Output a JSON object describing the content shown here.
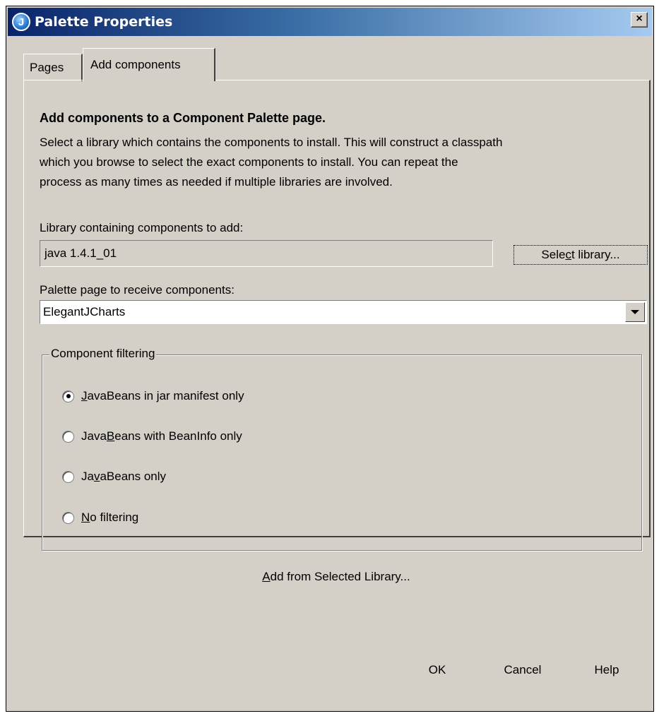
{
  "window": {
    "title": "Palette Properties",
    "close_glyph": "×"
  },
  "tabs": [
    {
      "label": "Pages",
      "selected": false
    },
    {
      "label": "Add components",
      "selected": true
    }
  ],
  "panel": {
    "heading": "Add components to a Component Palette page.",
    "description": [
      "Select a library which contains the components to install.  This will construct a classpath",
      "which you browse to select the exact components to install.  You can repeat the",
      "process as many times as needed if multiple libraries are involved."
    ],
    "library_label": "Library containing components to add:",
    "library_value": "java 1.4.1_01",
    "select_library_button": {
      "pre": "Sele",
      "mnemonic": "c",
      "post": "t library..."
    },
    "palette_label": "Palette page to receive components:",
    "palette_value": "ElegantJCharts"
  },
  "filtering": {
    "title": "Component filtering",
    "options": [
      {
        "pre": "",
        "mnemonic": "J",
        "post": "avaBeans in jar manifest only",
        "selected": true
      },
      {
        "pre": "Java",
        "mnemonic": "B",
        "post": "eans with BeanInfo only",
        "selected": false
      },
      {
        "pre": "Ja",
        "mnemonic": "v",
        "post": "aBeans only",
        "selected": false
      },
      {
        "pre": "",
        "mnemonic": "N",
        "post": "o filtering",
        "selected": false
      }
    ]
  },
  "add_from_button": {
    "pre": "",
    "mnemonic": "A",
    "post": "dd from Selected Library..."
  },
  "footer": {
    "ok": "OK",
    "cancel": "Cancel",
    "help": "Help"
  }
}
